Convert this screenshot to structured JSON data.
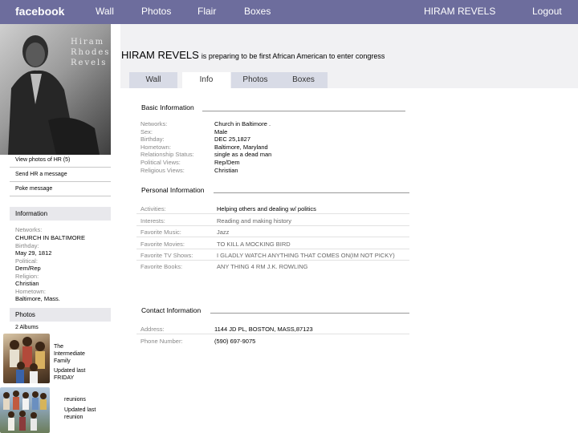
{
  "topbar": {
    "logo": "facebook",
    "nav": [
      "Wall",
      "Photos",
      "Flair",
      "Boxes"
    ],
    "user_name": "HIRAM REVELS",
    "logout": "Logout",
    "color": "#6d6d9d"
  },
  "photo": {
    "overlay_line1": "Hiram",
    "overlay_line2": "Rhodes",
    "overlay_line3": "Revels"
  },
  "profile": {
    "name": "HIRAM REVELS",
    "status": "is preparing to be first African American to enter congress"
  },
  "tabs": [
    "Wall",
    "Info",
    "Photos",
    "Boxes"
  ],
  "active_tab": "Info",
  "left_links": {
    "view_photos": "View photos of HR (5)",
    "send_message": "Send HR a message",
    "poke": "Poke message"
  },
  "left_info": {
    "title": "Information",
    "networks_label": "Networks:",
    "networks_value": "CHURCH IN BALTIMORE",
    "birthday_label": "Birthday:",
    "birthday_value": "May 29, 1812",
    "political_label": "Political:",
    "political_value": "Dem/Rep",
    "religion_label": "Religion:",
    "religion_value": "Christian",
    "hometown_label": "Hometown:",
    "hometown_value": "Baltimore, Mass."
  },
  "left_photos": {
    "title": "Photos",
    "albums_count": "2 Albums",
    "album1_title_l1": "The",
    "album1_title_l2": "Intermediate",
    "album1_title_l3": "Family",
    "album1_updated_l1": "Updated last",
    "album1_updated_l2": "FRIDAY",
    "album2_title": "reunions",
    "album2_updated_l1": "Updated last",
    "album2_updated_l2": "reunion"
  },
  "basic_info": {
    "title": "Basic Information",
    "labels": [
      "Networks:",
      "Sex:",
      "Birthday:",
      "Hometown:",
      "Relationship Status:",
      "Political Views:",
      "Religious Views:"
    ],
    "values": [
      "Church in Baltimore .",
      "Male",
      "DEC 25,1827",
      "Baltimore, Maryland",
      "single as a dead man",
      "Rep/Dem",
      "Christian"
    ]
  },
  "personal_info": {
    "title": "Personal Information",
    "rows": [
      {
        "label": "Activities:",
        "value": "Helping others and dealing w/ politics"
      },
      {
        "label": "Interests:",
        "value": "Reading and  making history"
      },
      {
        "label": "Favorite Music:",
        "value": "Jazz"
      },
      {
        "label": "Favorite Movies:",
        "value": "TO KILL A MOCKING BIRD"
      },
      {
        "label": "Favorite TV Shows:",
        "value": "I GLADLY WATCH ANYTHING THAT COMES ON(IM NOT PICKY)"
      },
      {
        "label": "Favorite Books:",
        "value": "ANY THING 4 RM J.K. ROWLING"
      }
    ]
  },
  "contact_info": {
    "title": "Contact Information",
    "address_label": "Address:",
    "address_value": "1144 JD PL, BOSTON, MASS,87123",
    "phone_label": "Phone Number:",
    "phone_value": "(590) 697-9075"
  }
}
